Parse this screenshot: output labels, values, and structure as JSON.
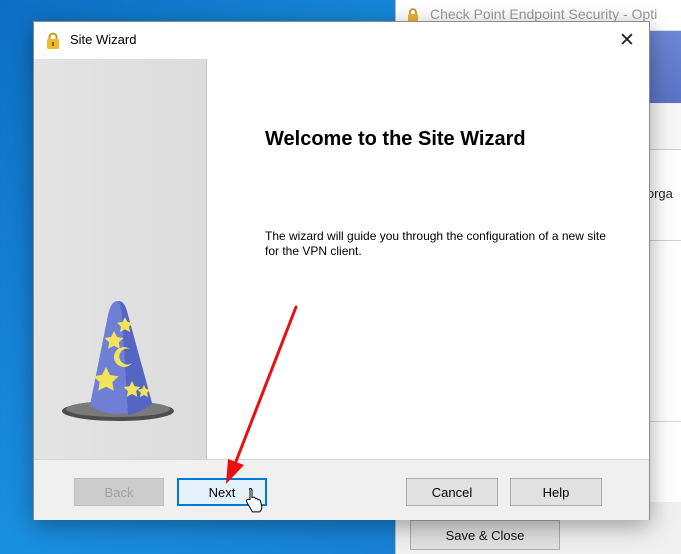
{
  "background_window": {
    "title": "Check Point Endpoint Security - Opti",
    "partial_text": "e orga",
    "save_close_label": "Save & Close",
    "icon": "lock-icon"
  },
  "dialog": {
    "title": "Site Wizard",
    "title_icon": "lock-icon",
    "close_label": "✕",
    "heading": "Welcome to the Site Wizard",
    "description": "The wizard will guide you through the configuration of a new site for the VPN client.",
    "illustration": "wizard-hat-icon",
    "buttons": {
      "back": "Back",
      "next": "Next",
      "cancel": "Cancel",
      "help": "Help"
    }
  },
  "annotation": {
    "arrow_color": "#e81010",
    "cursor_icon": "hand-pointer-icon"
  }
}
